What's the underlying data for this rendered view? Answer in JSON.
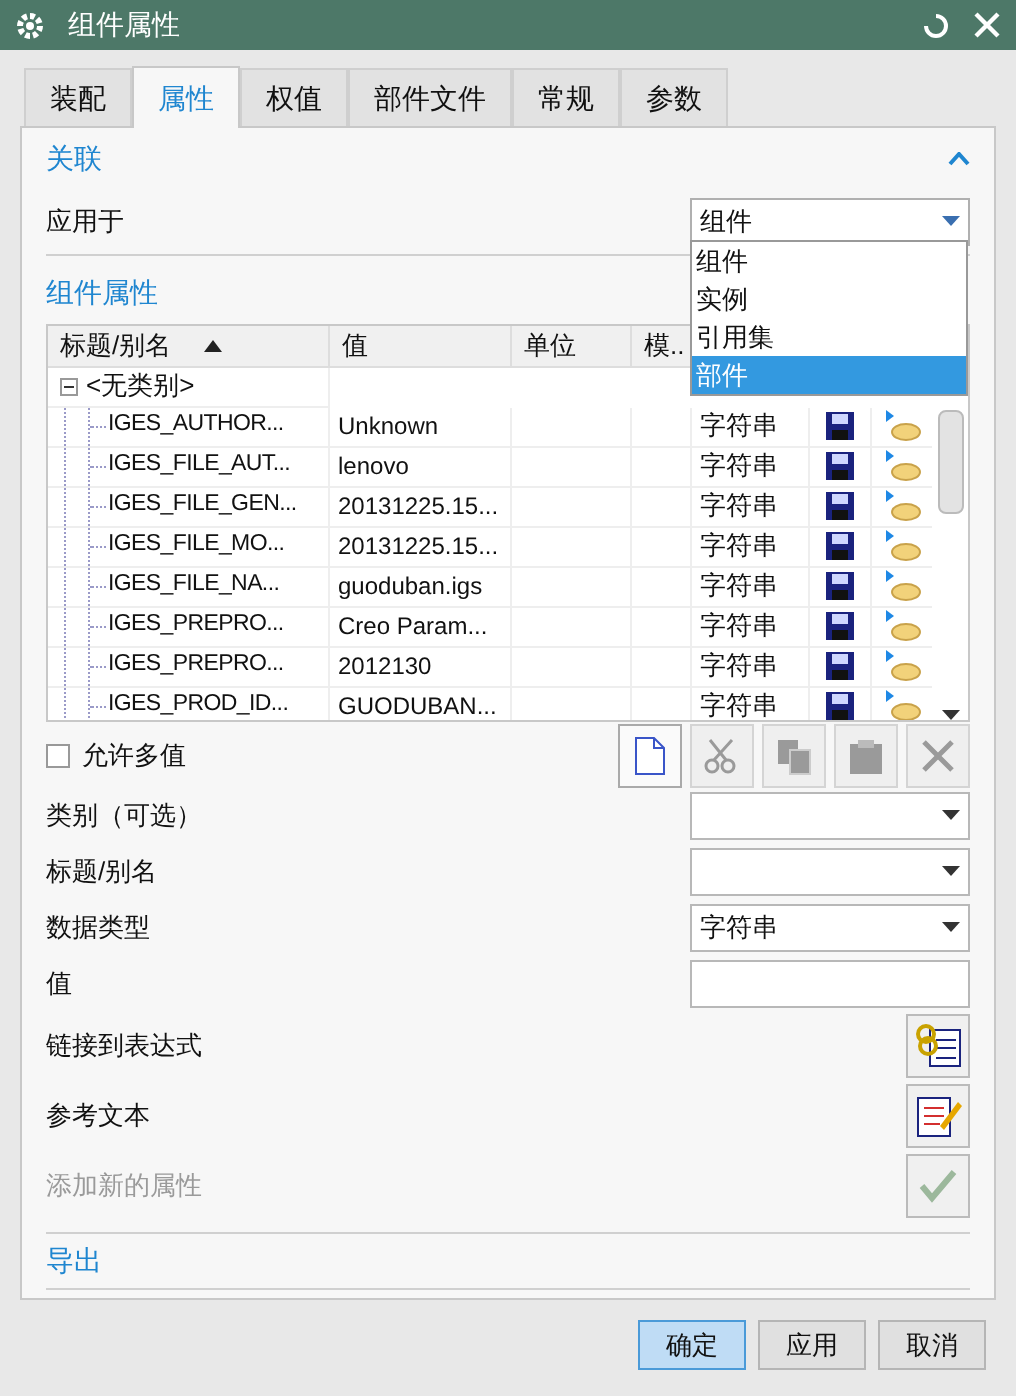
{
  "window": {
    "title": "组件属性"
  },
  "tabs": [
    {
      "label": "装配",
      "selected": false
    },
    {
      "label": "属性",
      "selected": true
    },
    {
      "label": "权值",
      "selected": false
    },
    {
      "label": "部件文件",
      "selected": false
    },
    {
      "label": "常规",
      "selected": false
    },
    {
      "label": "参数",
      "selected": false
    }
  ],
  "association": {
    "title": "关联",
    "expanded": true,
    "apply_to": {
      "label": "应用于",
      "value": "组件",
      "open": true,
      "options": [
        {
          "label": "组件",
          "highlighted": false
        },
        {
          "label": "实例",
          "highlighted": false
        },
        {
          "label": "引用集",
          "highlighted": false
        },
        {
          "label": "部件",
          "highlighted": true
        }
      ]
    }
  },
  "component_properties": {
    "title": "组件属性",
    "columns": [
      {
        "label": "标题/别名",
        "sorted": true
      },
      {
        "label": "值",
        "sorted": false
      },
      {
        "label": "单位",
        "sorted": false
      },
      {
        "label": "模..",
        "sorted": false
      }
    ],
    "group": {
      "label": "<无类别>",
      "expanded": true,
      "children": [
        {
          "name": "IGES_AUTHOR...",
          "value": "Unknown",
          "type": "字符串"
        },
        {
          "name": "IGES_FILE_AUT...",
          "value": "lenovo",
          "type": "字符串"
        },
        {
          "name": "IGES_FILE_GEN...",
          "value": "20131225.15...",
          "type": "字符串"
        },
        {
          "name": "IGES_FILE_MO...",
          "value": "20131225.15...",
          "type": "字符串"
        },
        {
          "name": "IGES_FILE_NA...",
          "value": "guoduban.igs",
          "type": "字符串"
        },
        {
          "name": "IGES_PREPRO...",
          "value": "Creo Param...",
          "type": "字符串"
        },
        {
          "name": "IGES_PREPRO...",
          "value": "2012130",
          "type": "字符串"
        },
        {
          "name": "IGES_PROD_ID...",
          "value": "GUODUBAN...",
          "type": "字符串"
        }
      ]
    }
  },
  "allow_multiple": {
    "label": "允许多值",
    "checked": false
  },
  "toolbar": [
    {
      "kind": "new",
      "disabled": false
    },
    {
      "kind": "cut",
      "disabled": true
    },
    {
      "kind": "copy",
      "disabled": true
    },
    {
      "kind": "paste",
      "disabled": true
    },
    {
      "kind": "delete",
      "disabled": true
    }
  ],
  "fields": [
    {
      "label": "类别（可选）",
      "kind": "dropdown"
    },
    {
      "label": "标题/别名",
      "kind": "dropdown"
    },
    {
      "label": "数据类型",
      "kind": "dropdown",
      "value": "字符串"
    },
    {
      "label": "值",
      "kind": "text"
    }
  ],
  "actions": [
    {
      "label": "链接到表达式",
      "kind": "expression",
      "disabled": false
    },
    {
      "label": "参考文本",
      "kind": "reference",
      "disabled": false
    },
    {
      "label": "添加新的属性",
      "kind": "add",
      "disabled": true
    }
  ],
  "export": {
    "title": "导出"
  },
  "buttons": [
    {
      "label": "确定",
      "default": true
    },
    {
      "label": "应用",
      "default": false
    },
    {
      "label": "取消",
      "default": false
    }
  ]
}
